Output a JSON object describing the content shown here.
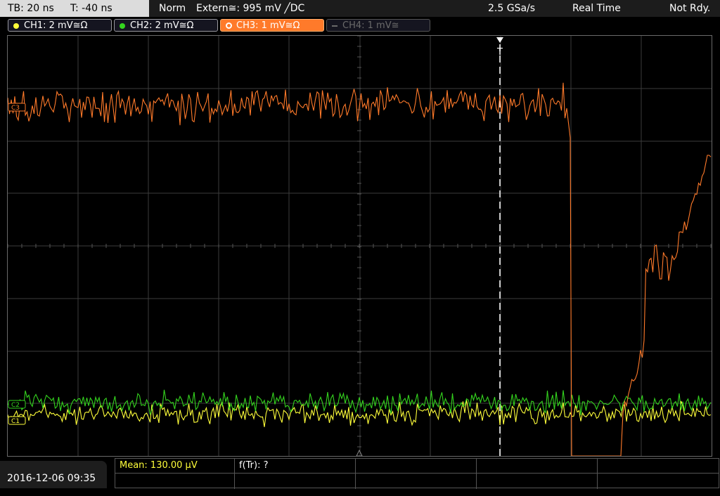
{
  "header": {
    "timebase": "TB: 20 ns",
    "trigger_time": "T: -40 ns",
    "trigger_mode": "Norm",
    "trigger_source": "Extern≅: 995 mV ╱DC",
    "sample_rate": "2.5 GSa/s",
    "acq_mode": "Real Time",
    "status": "Not Rdy."
  },
  "channels": [
    {
      "label": "CH1: 2 mV≅Ω",
      "color": "#ffff3a",
      "state": "on"
    },
    {
      "label": "CH2: 2 mV≅Ω",
      "color": "#34d41e",
      "state": "on"
    },
    {
      "label": "CH3: 1 mV≅Ω",
      "color": "#ff7a2a",
      "state": "active"
    },
    {
      "label": "CH4: 1 mV≅",
      "color": "#6a6a6a",
      "state": "off"
    }
  ],
  "markers": {
    "c3": "C3",
    "c2": "C2",
    "c1": "C1",
    "trigger": "T"
  },
  "footer": {
    "datetime": "2016-12-06 09:35",
    "mean": "Mean: 130.00 µV",
    "freq": "f(Tr): ?"
  },
  "colors": {
    "ch1": "#ffff3a",
    "ch2": "#34d41e",
    "ch3": "#ff7a2a",
    "grid": "#3c3c3c",
    "mean_text": "#ffff3a"
  }
}
